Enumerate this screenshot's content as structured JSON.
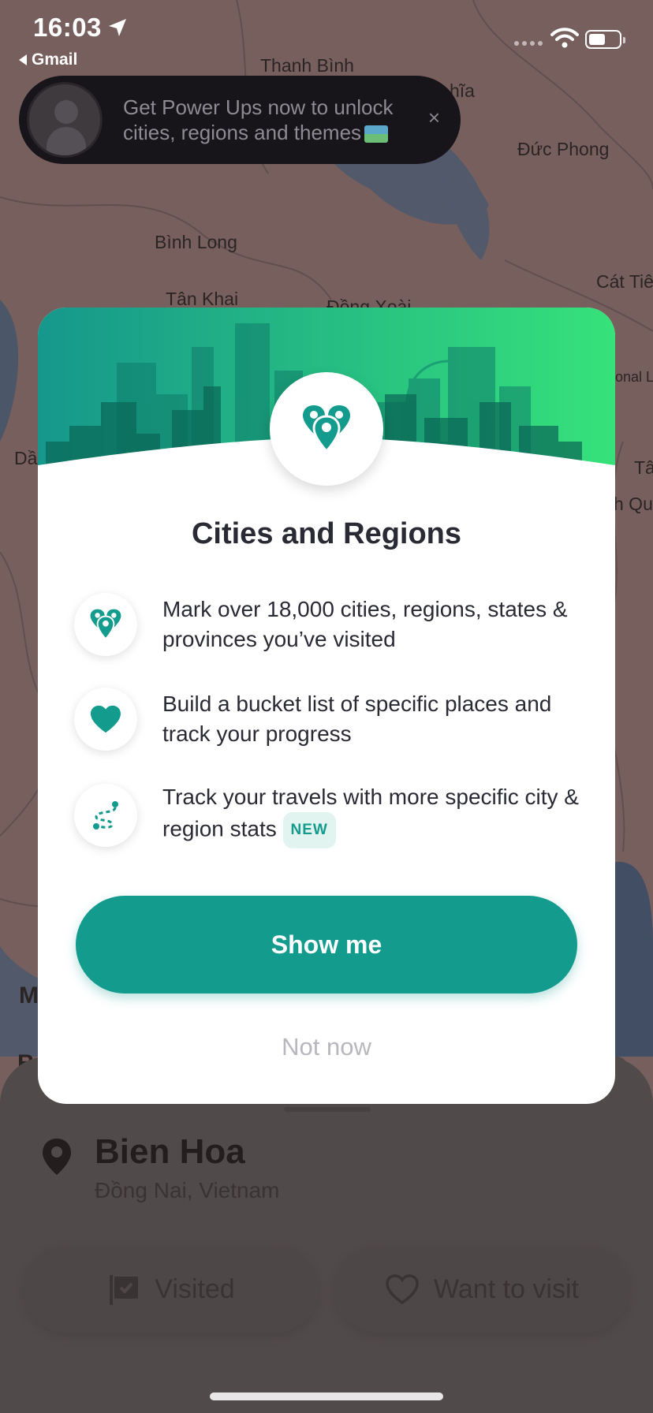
{
  "status_bar": {
    "time": "16:03",
    "back_app": "Gmail"
  },
  "banner": {
    "text": "Get Power Ups now to unlock cities, regions and themes",
    "close": "×"
  },
  "map": {
    "labels": [
      "Thanh Bình",
      "hĩa",
      "Đức Phong",
      "Bình Long",
      "Tân Khai",
      "Đồng Xoài",
      "Cát Tiê",
      "Dầ",
      "Tâ",
      "h Qu",
      "onal L",
      "M",
      "Bo"
    ]
  },
  "modal": {
    "title": "Cities and Regions",
    "features": [
      {
        "icon": "map-pins-icon",
        "text": "Mark over 18,000 cities, regions, states & provinces you’ve visited"
      },
      {
        "icon": "heart-icon",
        "text": "Build a bucket list of specific places and track your progress"
      },
      {
        "icon": "route-icon",
        "text": "Track your travels with more specific city & region stats",
        "badge": "NEW"
      }
    ],
    "primary_button": "Show me",
    "secondary_button": "Not now",
    "accent_color": "#139b8e"
  },
  "sheet": {
    "place": "Bien Hoa",
    "region": "Đồng Nai, Vietnam",
    "visited_button": "Visited",
    "want_button": "Want to visit"
  }
}
